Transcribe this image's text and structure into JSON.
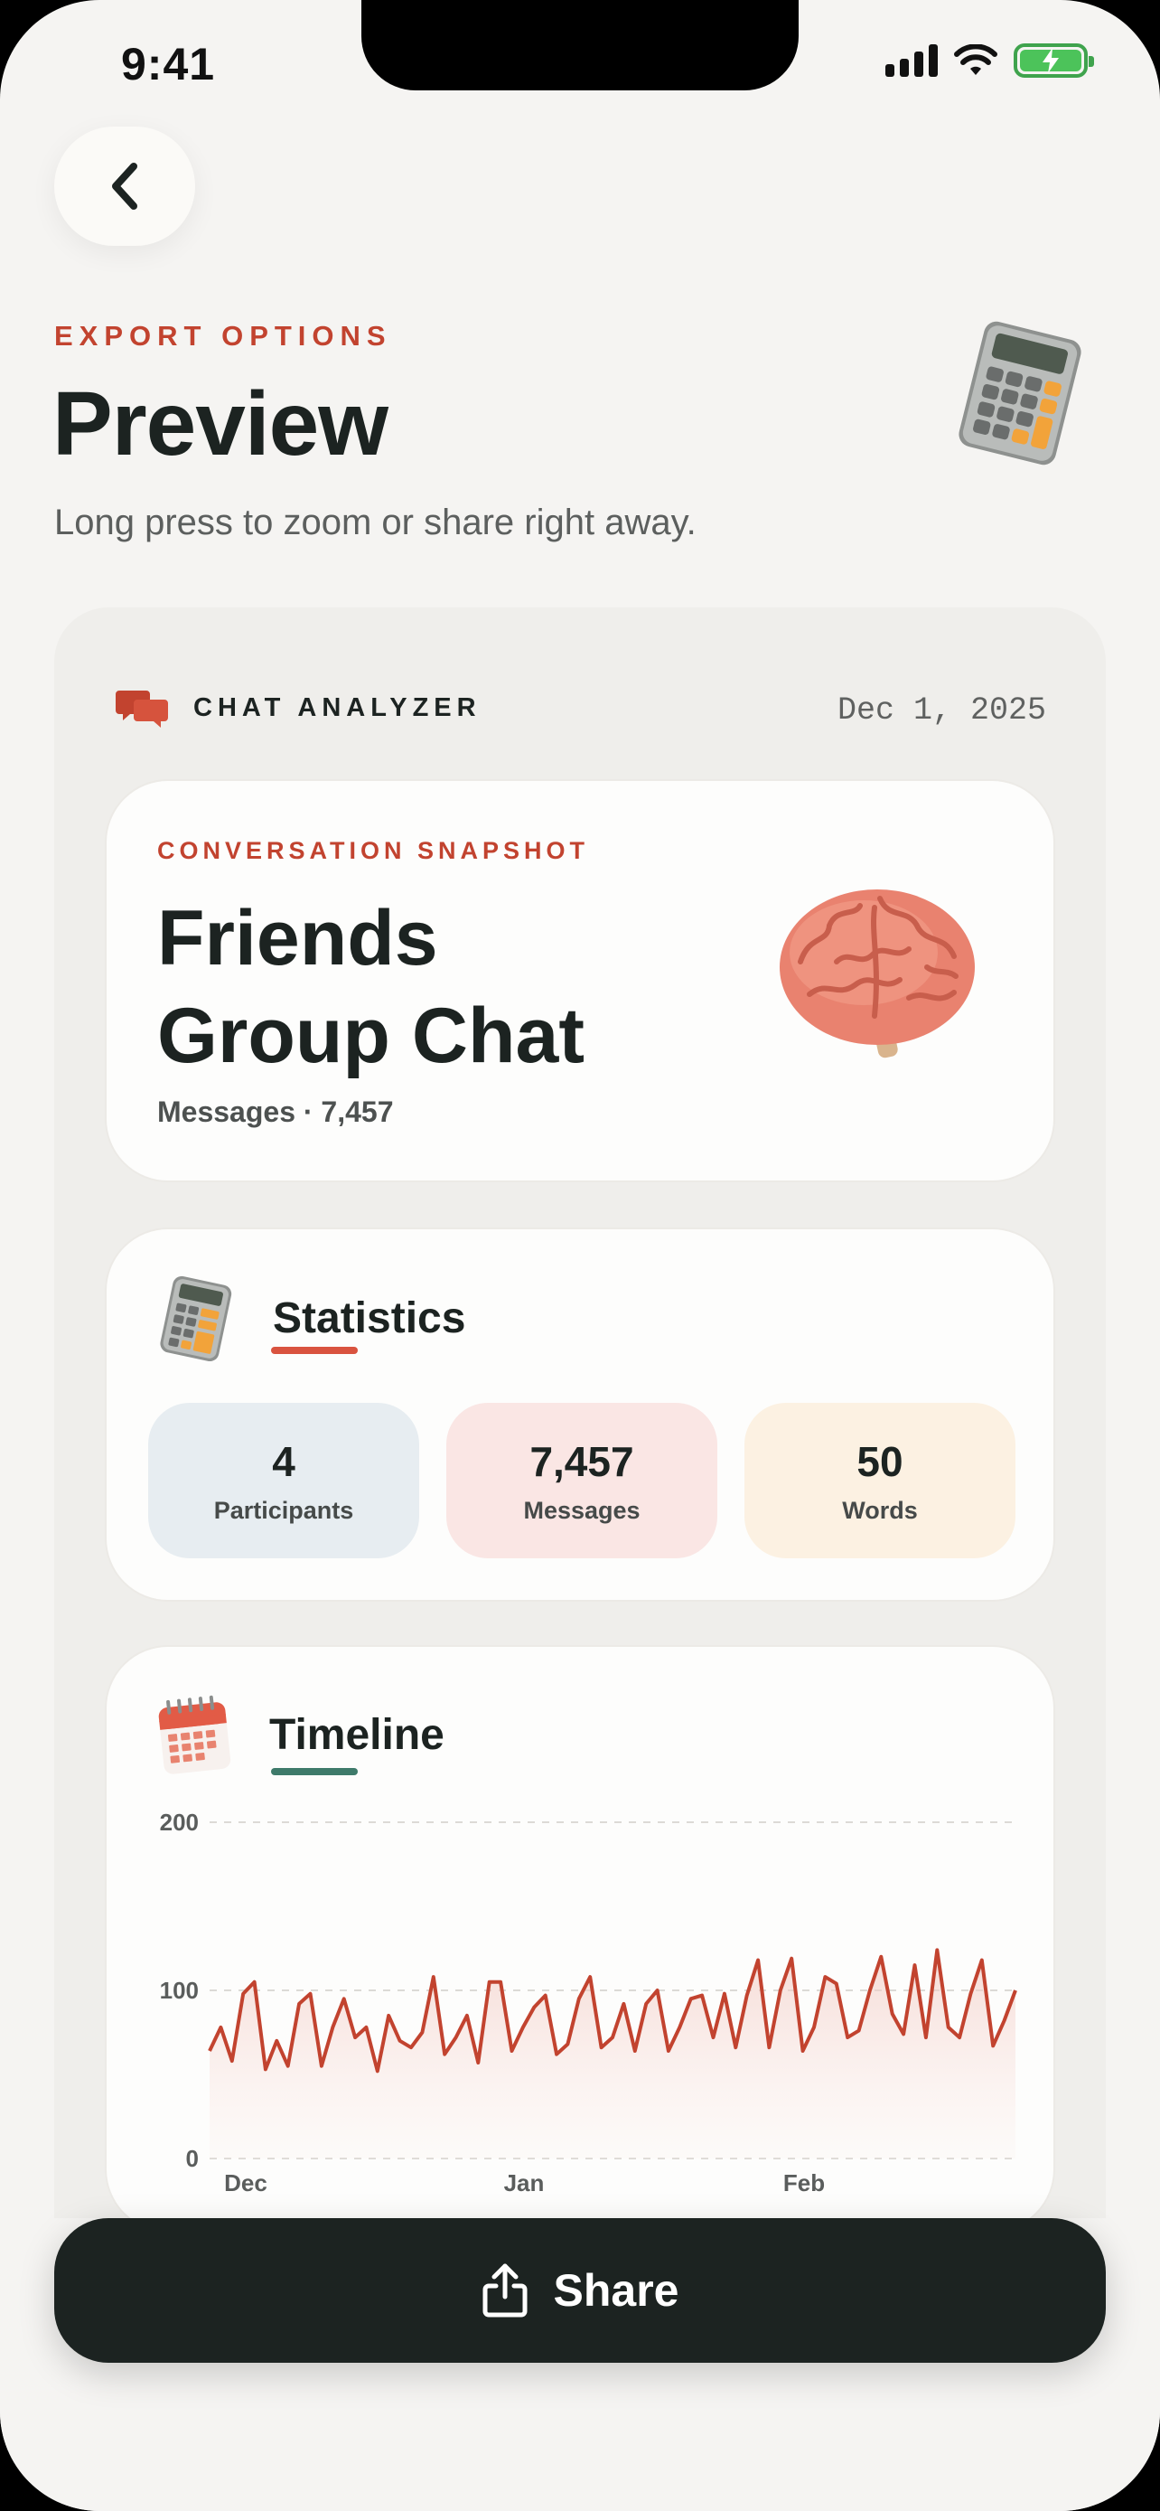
{
  "status_bar": {
    "time": "9:41"
  },
  "header": {
    "eyebrow": "EXPORT OPTIONS",
    "title": "Preview",
    "subtitle": "Long press to zoom or share right away."
  },
  "export_card": {
    "brand": "CHAT ANALYZER",
    "date": "Dec 1, 2025",
    "snapshot": {
      "eyebrow": "CONVERSATION SNAPSHOT",
      "title_line1": "Friends",
      "title_line2": "Group Chat",
      "meta": "Messages · 7,457"
    },
    "statistics": {
      "title": "Statistics",
      "items": [
        {
          "value": "4",
          "label": "Participants",
          "color": "#e7edf1"
        },
        {
          "value": "7,457",
          "label": "Messages",
          "color": "#fae6e4"
        },
        {
          "value": "50",
          "label": "Words",
          "color": "#fcf1e2"
        }
      ]
    },
    "timeline": {
      "title": "Timeline"
    }
  },
  "chart_data": {
    "type": "area",
    "title": "Timeline",
    "ylim": [
      0,
      200
    ],
    "y_ticks": [
      "200",
      "100",
      "0"
    ],
    "x_labels": [
      "Dec",
      "Jan",
      "Feb"
    ],
    "grid": true,
    "color": "#c2432f",
    "values": [
      64,
      78,
      58,
      98,
      105,
      53,
      70,
      55,
      92,
      98,
      55,
      78,
      95,
      72,
      78,
      52,
      85,
      70,
      66,
      75,
      108,
      62,
      72,
      85,
      57,
      105,
      105,
      64,
      78,
      90,
      97,
      62,
      68,
      95,
      108,
      66,
      72,
      92,
      64,
      92,
      100,
      64,
      78,
      95,
      97,
      72,
      98,
      66,
      97,
      118,
      66,
      100,
      119,
      64,
      78,
      108,
      104,
      72,
      76,
      100,
      120,
      86,
      74,
      115,
      72,
      124,
      78,
      72,
      98,
      118,
      67,
      82,
      100
    ]
  },
  "share_button": {
    "label": "Share"
  },
  "colors": {
    "accent": "#c2432f",
    "dark": "#1c2321",
    "timeline_accent": "#3e7a6a"
  }
}
